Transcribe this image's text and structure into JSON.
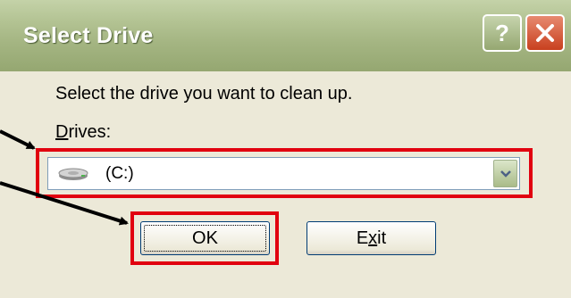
{
  "dialog": {
    "title": "Select Drive",
    "help_symbol": "?",
    "instruction": "Select the drive you want to clean up.",
    "drives_label_mnemonic": "D",
    "drives_label_rest": "rives:",
    "selected_drive": "(C:)",
    "ok_label": "OK",
    "exit_label_pre": "E",
    "exit_label_mnemonic": "x",
    "exit_label_post": "it"
  },
  "icons": {
    "help": "help-icon",
    "close": "close-icon",
    "drive": "hard-drive-icon",
    "dropdown": "chevron-down-icon"
  },
  "colors": {
    "titlebar": "#a4b582",
    "dialog_bg": "#ece9d8",
    "highlight": "#e1000f",
    "close_button": "#c8401e"
  }
}
